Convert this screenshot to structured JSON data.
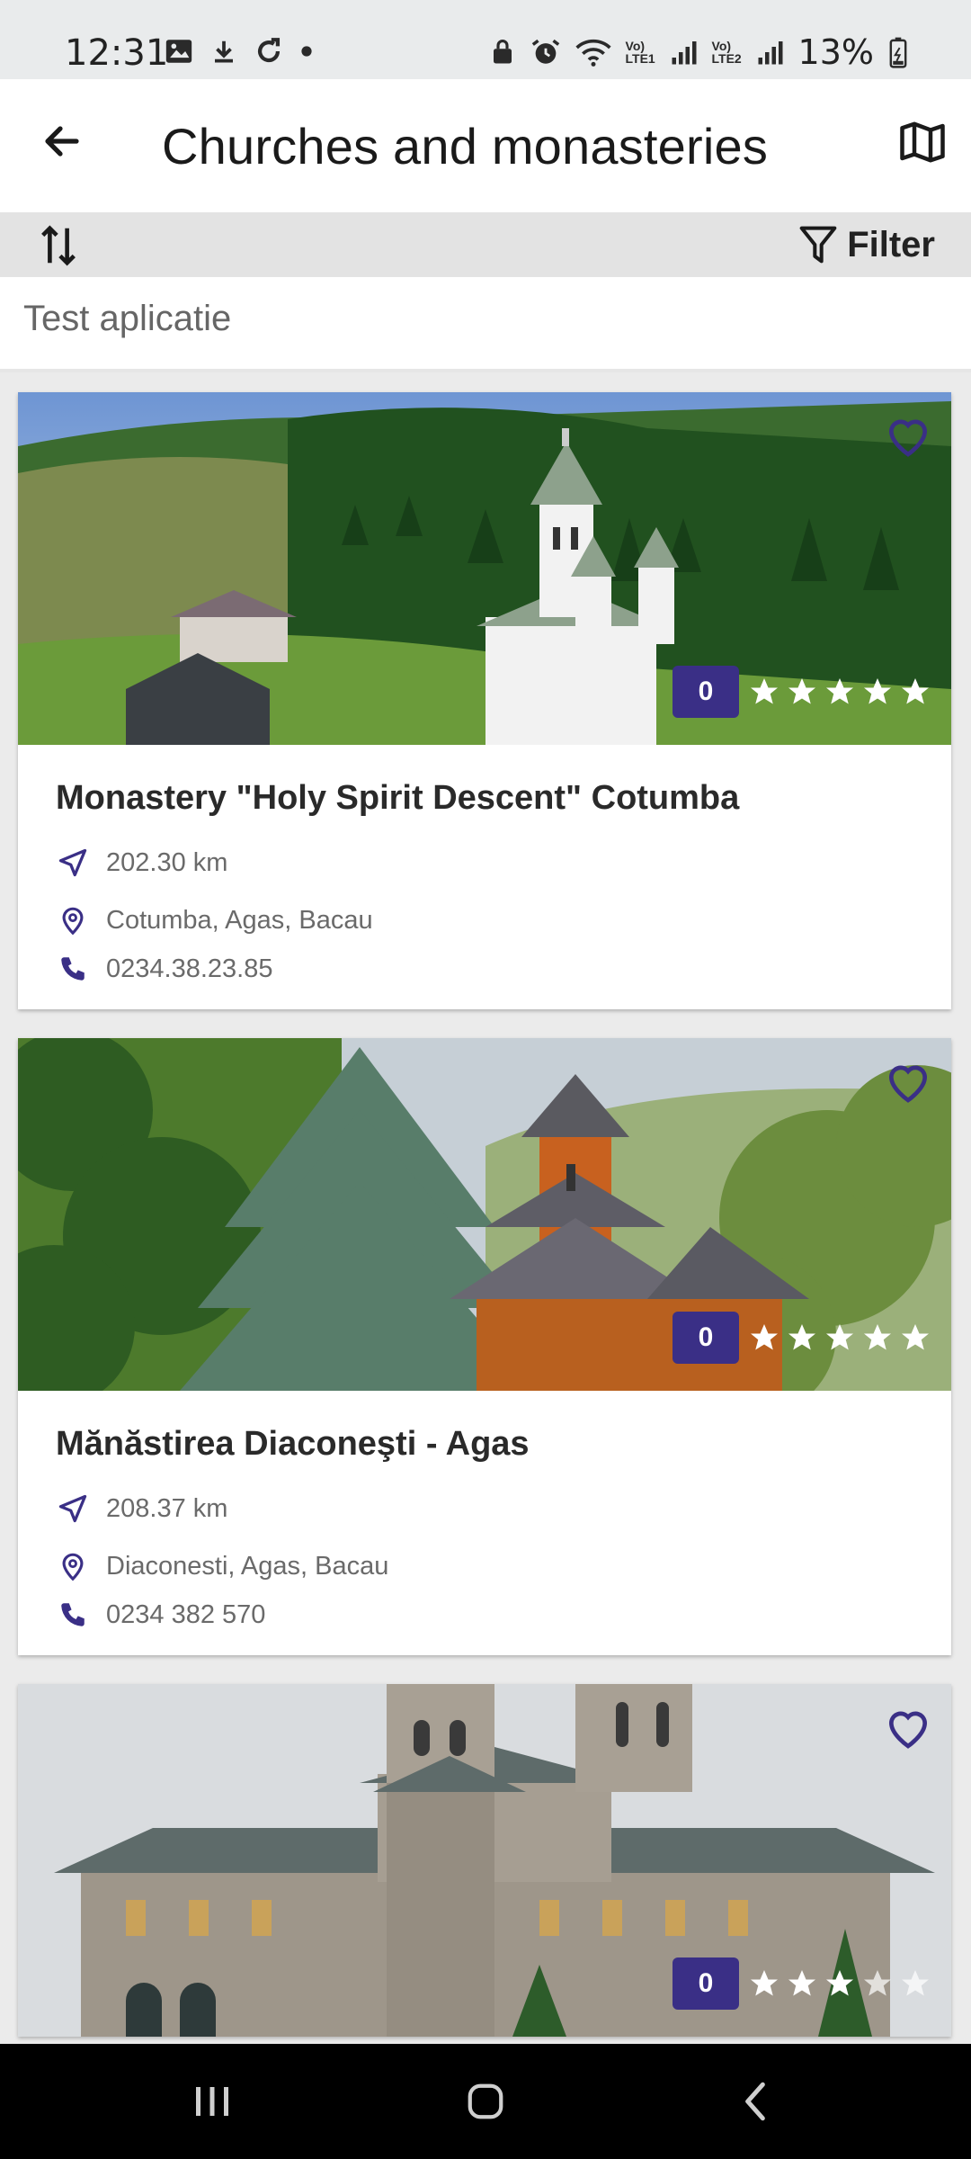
{
  "status_bar": {
    "time": "12:31",
    "battery": "13%",
    "network1": "Vo) LTE1",
    "network2": "Vo) LTE2"
  },
  "app_bar": {
    "title": "Churches and monasteries",
    "back_icon": "arrow-left-icon",
    "map_icon": "map-icon"
  },
  "toolbar": {
    "sort_icon": "sort-arrows-icon",
    "filter_label": "Filter"
  },
  "search": {
    "label": "Test aplicatie"
  },
  "accent_color": "#3a2f86",
  "places": [
    {
      "title": "Monastery \"Holy Spirit Descent\" Cotumba",
      "distance": "202.30 km",
      "address": "Cotumba, Agas, Bacau",
      "phone": "0234.38.23.85",
      "rating_count": "0",
      "stars": 0
    },
    {
      "title": "Mănăstirea Diaconeşti - Agas",
      "distance": "208.37 km",
      "address": "Diaconesti, Agas, Bacau",
      "phone": "0234 382 570",
      "rating_count": "0",
      "stars": 0
    },
    {
      "title": "",
      "distance": "",
      "address": "",
      "phone": "",
      "rating_count": "0",
      "stars": 0
    }
  ]
}
